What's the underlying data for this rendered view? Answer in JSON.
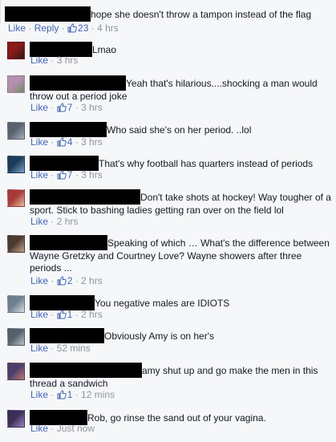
{
  "labels": {
    "like": "Like",
    "reply": "Reply",
    "sep": " · "
  },
  "colors": {
    "background": "#f6f7f9",
    "link": "#4267b2",
    "meta": "#90949c",
    "text": "#141823"
  },
  "comments": [
    {
      "text": "hope she doesn't throw a tampon instead of the flag",
      "likes": "23",
      "time": "4 hrs",
      "avatar_colors": [
        "#6b5a4a",
        "#c9b8a6"
      ]
    },
    {
      "text": "Lmao",
      "likes": "",
      "time": "3 hrs",
      "avatar_colors": [
        "#8b1a1a",
        "#2a1a1a"
      ]
    },
    {
      "text": "Yeah that's hilarious....shocking a man would throw out a period joke",
      "likes": "7",
      "time": "3 hrs",
      "avatar_colors": [
        "#b58fb0",
        "#6f8b5b"
      ]
    },
    {
      "text": "Who said she's on her period. ..lol",
      "likes": "4",
      "time": "3 hrs",
      "avatar_colors": [
        "#5a6270",
        "#a9b0bb"
      ]
    },
    {
      "text": "That's why football has quarters instead of periods",
      "likes": "7",
      "time": "3 hrs",
      "avatar_colors": [
        "#1c3d5a",
        "#7fa3c2"
      ]
    },
    {
      "text": "Don't take shots at hockey! Way tougher of a sport. Stick to bashing ladies getting ran over on the field lol",
      "likes": "",
      "time": "2 hrs",
      "avatar_colors": [
        "#a83a3a",
        "#e0c1a0"
      ]
    },
    {
      "text": "Speaking of which … What's the difference between Wayne Gretzky and Courtney Love? Wayne showers after three periods ...",
      "likes": "2",
      "time": "2 hrs",
      "avatar_colors": [
        "#4a3a30",
        "#c8a58a"
      ]
    },
    {
      "text": "You negative males are IDIOTS",
      "likes": "1",
      "time": "2 hrs",
      "avatar_colors": [
        "#6f7f8f",
        "#d7dde3"
      ]
    },
    {
      "text": "Obviously Amy is on her's",
      "likes": "",
      "time": "52 mins",
      "avatar_colors": [
        "#53606b",
        "#b8c3cc"
      ]
    },
    {
      "text": "amy shut up and go make the men in this thread a sandwich",
      "likes": "1",
      "time": "12 mins",
      "avatar_colors": [
        "#4b3f6b",
        "#c07a6a"
      ]
    },
    {
      "text": "Rob, go rinse the sand out of your vagina.",
      "likes": "",
      "time": "Just now",
      "avatar_colors": [
        "#3b2f55",
        "#9a86c0"
      ]
    }
  ]
}
